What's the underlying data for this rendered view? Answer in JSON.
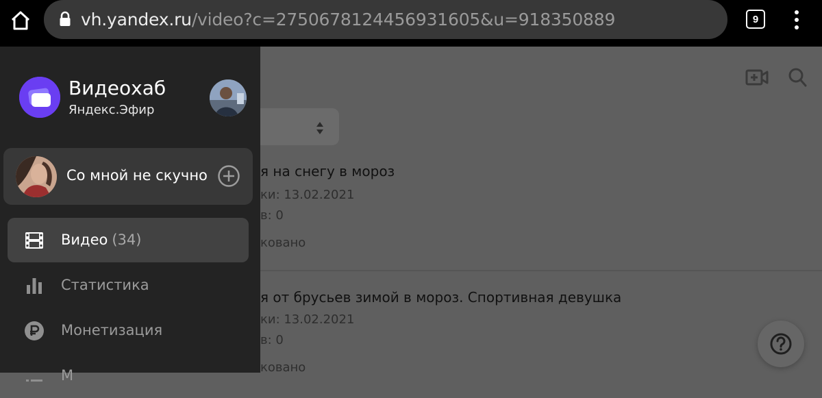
{
  "browser": {
    "url_host": "vh.yandex.ru",
    "url_rest": "/video?c=2750678124456931605&u=918350889",
    "tabs_count": "9"
  },
  "background": {
    "items": [
      {
        "title": "я на снегу в мороз",
        "date": "ки: 13.02.2021",
        "views": "в: 0",
        "status": "ковано"
      },
      {
        "title": "я от брусьев зимой в мороз. Спортивная девушка",
        "date": "ки: 13.02.2021",
        "views": "в: 0",
        "status": "ковано"
      }
    ]
  },
  "drawer": {
    "hub_title": "Видеохаб",
    "hub_subtitle": "Яндекс.Эфир",
    "channel_name": "Со мной не скучно",
    "nav": [
      {
        "label": "Видео",
        "count": "(34)",
        "icon": "film-icon",
        "active": true
      },
      {
        "label": "Статистика",
        "icon": "bar-chart-icon",
        "active": false
      },
      {
        "label": "Монетизация",
        "icon": "ruble-icon",
        "active": false
      },
      {
        "label": "М",
        "icon": "list-icon",
        "active": false
      }
    ]
  }
}
